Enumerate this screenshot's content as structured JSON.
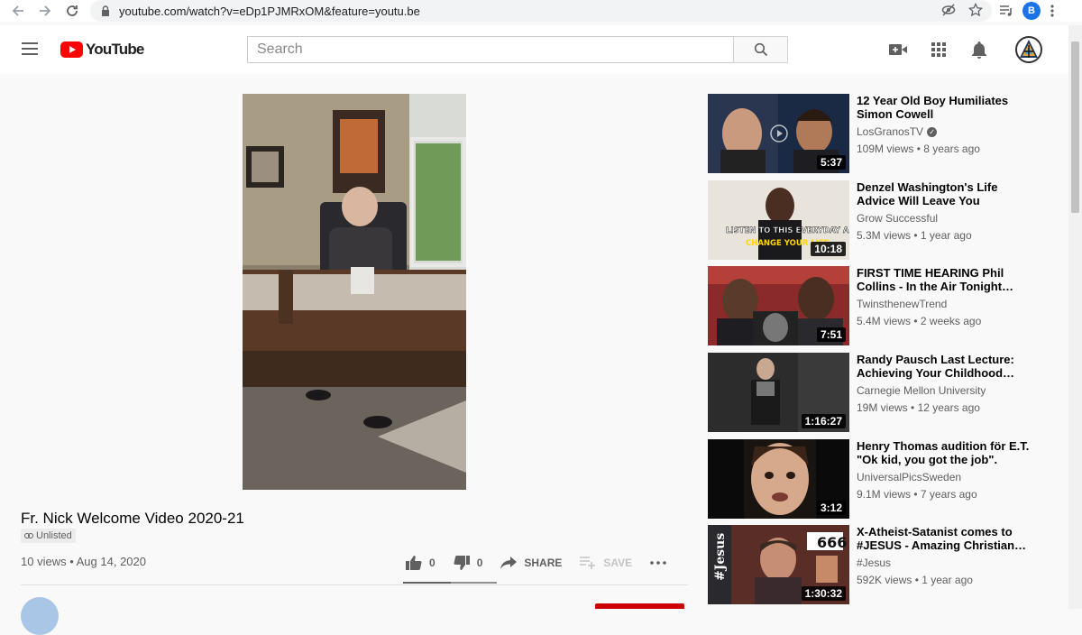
{
  "browser": {
    "url": "youtube.com/watch?v=eDp1PJMRxOM&feature=youtu.be",
    "profile_initial": "B"
  },
  "header": {
    "logo_text": "YouTube",
    "search_placeholder": "Search"
  },
  "video": {
    "title": "Fr. Nick Welcome Video 2020-21",
    "badge": "Unlisted",
    "views": "10 views",
    "date": "Aug 14, 2020",
    "likes": "0",
    "dislikes": "0",
    "share_label": "SHARE",
    "save_label": "SAVE"
  },
  "recommendations": [
    {
      "title": "12 Year Old Boy Humiliates Simon Cowell",
      "channel": "LosGranosTV",
      "verified": true,
      "views": "109M views",
      "age": "8 years ago",
      "duration": "5:37"
    },
    {
      "title": "Denzel Washington's Life Advice Will Leave You SPEECHLESS…",
      "channel": "Grow Successful",
      "verified": false,
      "views": "5.3M views",
      "age": "1 year ago",
      "duration": "10:18",
      "thumb_text_1": "LISTEN TO THIS EVERYDAY AND",
      "thumb_text_2": "CHANGE YOUR LIFE"
    },
    {
      "title": "FIRST TIME HEARING Phil Collins - In the Air Tonight…",
      "channel": "TwinsthenewTrend",
      "verified": false,
      "views": "5.4M views",
      "age": "2 weeks ago",
      "duration": "7:51"
    },
    {
      "title": "Randy Pausch Last Lecture: Achieving Your Childhood…",
      "channel": "Carnegie Mellon University",
      "verified": false,
      "views": "19M views",
      "age": "12 years ago",
      "duration": "1:16:27"
    },
    {
      "title": "Henry Thomas audition för E.T. \"Ok kid, you got the job\".",
      "channel": "UniversalPicsSweden",
      "verified": false,
      "views": "9.1M views",
      "age": "7 years ago",
      "duration": "3:12"
    },
    {
      "title": "X-Atheist-Satanist comes to #JESUS - Amazing Christian…",
      "channel": "#Jesus",
      "verified": false,
      "views": "592K views",
      "age": "1 year ago",
      "duration": "1:30:32",
      "thumb_text_1": "#Jesus",
      "thumb_text_2": "666"
    }
  ],
  "colors": {
    "brand": "#ff0000",
    "page_bg": "#f9f9f9",
    "text_secondary": "#606060"
  }
}
